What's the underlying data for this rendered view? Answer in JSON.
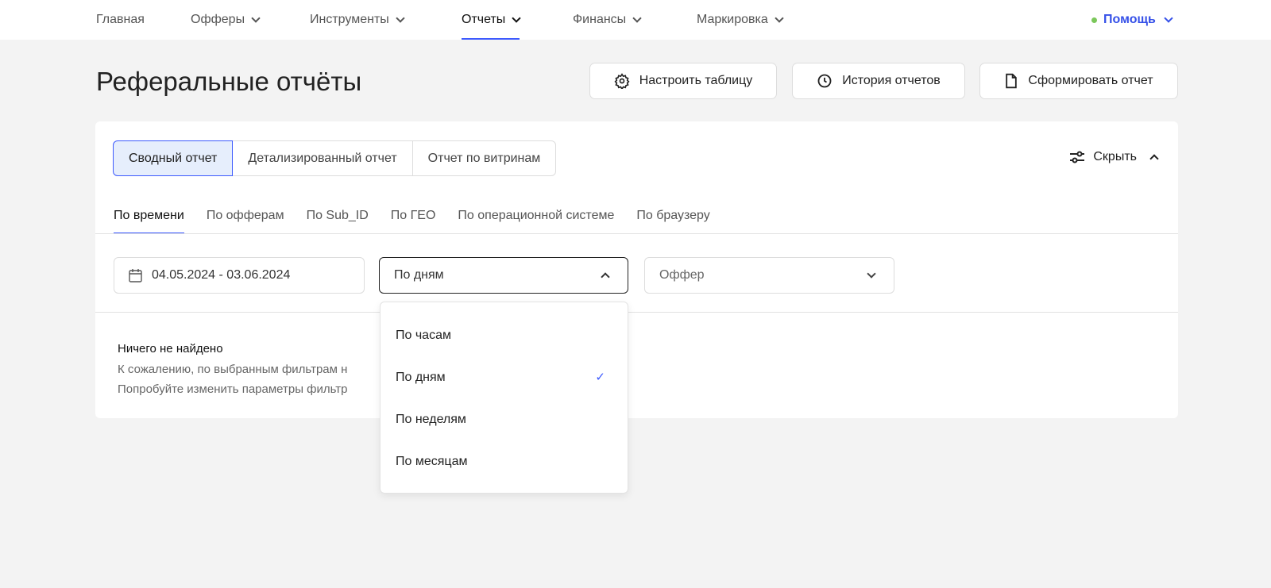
{
  "nav": {
    "items": [
      {
        "label": "Главная",
        "dropdown": false
      },
      {
        "label": "Офферы",
        "dropdown": true
      },
      {
        "label": "Инструменты",
        "dropdown": true
      },
      {
        "label": "Отчеты",
        "dropdown": true,
        "active": true
      },
      {
        "label": "Финансы",
        "dropdown": true
      },
      {
        "label": "Маркировка",
        "dropdown": true
      }
    ],
    "help": "Помощь"
  },
  "page": {
    "title": "Реферальные отчёты"
  },
  "actions": {
    "configure": "Настроить таблицу",
    "history": "История отчетов",
    "generate": "Сформировать отчет"
  },
  "report_types": [
    "Сводный отчет",
    "Детализированный отчет",
    "Отчет по витринам"
  ],
  "hide_label": "Скрыть",
  "subtabs": [
    "По времени",
    "По офферам",
    "По Sub_ID",
    "По ГЕО",
    "По операционной системе",
    "По браузеру"
  ],
  "filters": {
    "date_range": "04.05.2024 - 03.06.2024",
    "grouping": "По дням",
    "offer_placeholder": "Оффер"
  },
  "dropdown": {
    "options": [
      "По часам",
      "По дням",
      "По неделям",
      "По месяцам"
    ],
    "selected": "По дням"
  },
  "empty": {
    "title": "Ничего не найдено",
    "line1": "К сожалению, по выбранным фильтрам н",
    "line2": "Попробуйте изменить параметры фильтр"
  },
  "colors": {
    "accent": "#3d5afe",
    "help": "#3550e8",
    "status_dot": "#7bc75a"
  }
}
